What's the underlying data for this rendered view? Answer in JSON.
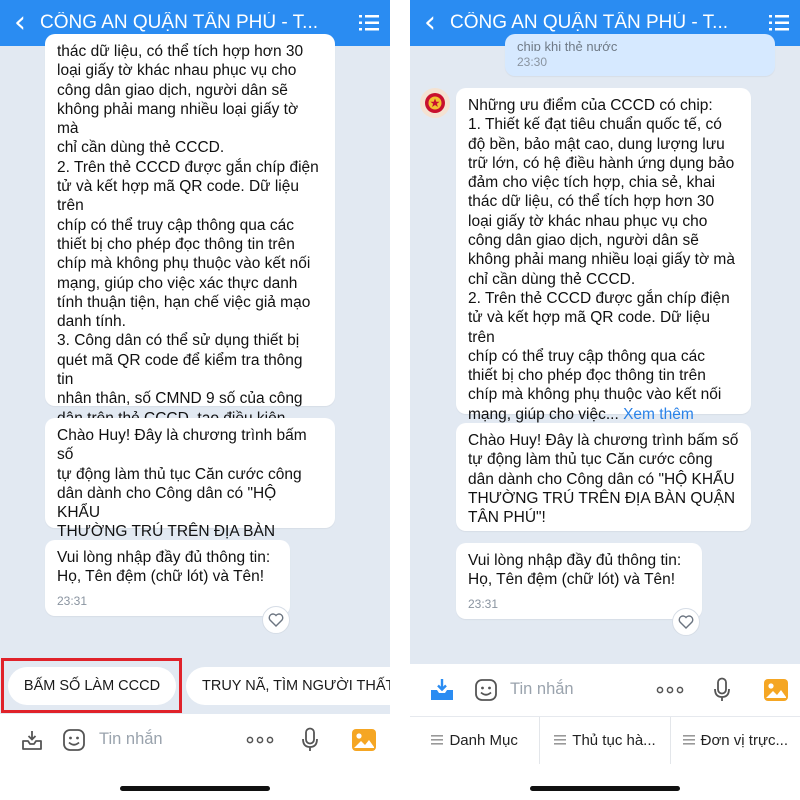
{
  "left": {
    "header": {
      "title": "CÔNG AN QUẬN TÂN PHÚ - T..."
    },
    "messages": [
      {
        "text": "thác dữ liệu, có thể tích hợp hơn 30\nloại giấy tờ khác nhau phục vụ cho\ncông dân giao dịch, người dân sẽ\nkhông phải mang nhiều loại giấy tờ mà\nchỉ cần dùng thẻ CCCD.\n2. Trên thẻ CCCD được gắn chíp điện\ntử và kết hợp mã QR code. Dữ liệu trên\nchíp có thể truy cập thông qua các\nthiết bị cho phép đọc thông tin trên\nchíp mà không phụ thuộc vào kết nối\nmạng, giúp cho việc xác thực danh\ntính thuận tiện, hạn chế việc giả mạo\ndanh tính.\n3. Công dân có thể sử dụng thiết bị\nquét mã QR code để kiểm tra thông tin\nnhân thân, số CMND 9 số của công\ndân trên thẻ CCCD, tạo điều kiện\nthuận lợi cho công dân trong việc thực\nhiện các giao dịch"
      },
      {
        "text": "Chào Huy! Đây là chương trình bấm số\ntự động làm thủ tục Căn cước công\ndân dành cho Công dân có \"HỘ KHẨU\nTHƯỜNG TRÚ TRÊN ĐỊA BÀN QUẬN\nTÂN PHÚ\"!"
      },
      {
        "text": "Vui lòng nhập đầy đủ thông tin:\nHọ, Tên đệm (chữ lót) và Tên!",
        "time": "23:31"
      }
    ],
    "chips": [
      "BẤM SỐ LÀM CCCD",
      "TRUY NÃ, TÌM NGƯỜI THẤT"
    ],
    "input_placeholder": "Tin nhắn"
  },
  "right": {
    "header": {
      "title": "CÔNG AN QUẬN TÂN PHÚ - T..."
    },
    "sent_partial": {
      "text": "chip khi thẻ nước",
      "time": "23:30"
    },
    "messages": [
      {
        "text": "Những ưu điểm của CCCD có chip:\n1. Thiết kế đạt tiêu chuẩn quốc tế, có\nđộ bền, bảo mật cao, dung lượng lưu\ntrữ lớn, có hệ điều hành ứng dụng bảo\nđảm cho việc tích hợp, chia sẻ, khai\nthác dữ liệu, có thể tích hợp hơn 30\nloại giấy tờ khác nhau phục vụ cho\ncông dân giao dịch, người dân sẽ\nkhông phải mang nhiều loại giấy tờ mà\nchỉ cần dùng thẻ CCCD.\n2. Trên thẻ CCCD được gắn chíp điện\ntử và kết hợp mã QR code. Dữ liệu trên\nchíp có thể truy cập thông qua các\nthiết bị cho phép đọc thông tin trên\nchíp mà không phụ thuộc vào kết nối\nmạng, giúp cho việc...",
        "more": "Xem thêm"
      },
      {
        "text": "Chào Huy! Đây là chương trình bấm số\ntự động làm thủ tục Căn cước công\ndân dành cho Công dân có \"HỘ KHẨU\nTHƯỜNG TRÚ TRÊN ĐỊA BÀN QUẬN\nTÂN PHÚ\"!"
      },
      {
        "text": "Vui lòng nhập đầy đủ thông tin:\nHọ, Tên đệm (chữ lót) và Tên!",
        "time": "23:31"
      }
    ],
    "input_placeholder": "Tin nhắn",
    "menu": [
      "Danh Mục",
      "Thủ tục hà...",
      "Đơn vị trực..."
    ]
  },
  "colors": {
    "header": "#2a8cf2",
    "chat_bg": "#e2e9f2",
    "highlight": "#e0222a",
    "link": "#2a82e8"
  }
}
